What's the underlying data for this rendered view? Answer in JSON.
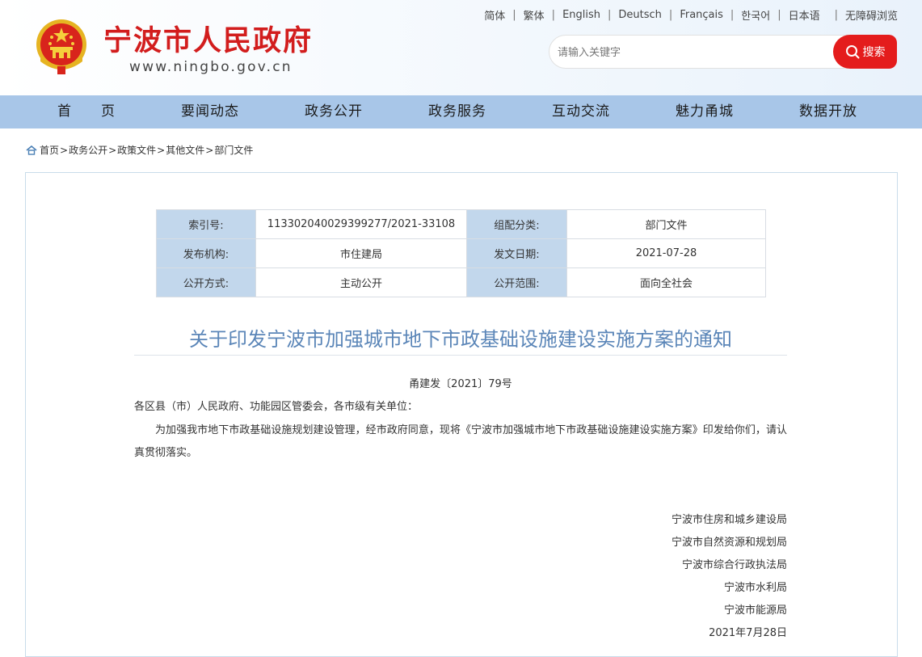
{
  "header": {
    "site_name": "宁波市人民政府",
    "site_url": "www.ningbo.gov.cn",
    "languages": [
      "简体",
      "繁体",
      "English",
      "Deutsch",
      "Français",
      "한국어",
      "日本语",
      "无障碍浏览"
    ],
    "search": {
      "placeholder": "请输入关键字",
      "button_label": "搜索"
    },
    "brand_red": "#d21d1d"
  },
  "nav": {
    "items": [
      "首　　页",
      "要闻动态",
      "政务公开",
      "政务服务",
      "互动交流",
      "魅力甬城",
      "数据开放"
    ],
    "bg_color": "#a8c6e8"
  },
  "breadcrumb": [
    "首页",
    "政务公开",
    "政策文件",
    "其他文件",
    "部门文件"
  ],
  "meta_table": [
    {
      "k1": "索引号:",
      "v1": "113302040029399277/2021-33108",
      "k2": "组配分类:",
      "v2": "部门文件"
    },
    {
      "k1": "发布机构:",
      "v1": "市住建局",
      "k2": "发文日期:",
      "v2": "2021-07-28"
    },
    {
      "k1": "公开方式:",
      "v1": "主动公开",
      "k2": "公开范围:",
      "v2": "面向全社会"
    }
  ],
  "document": {
    "title": "关于印发宁波市加强城市地下市政基础设施建设实施方案的通知",
    "doc_number": "甬建发〔2021〕79号",
    "addressee": "各区县（市）人民政府、功能园区管委会，各市级有关单位：",
    "body": "为加强我市地下市政基础设施规划建设管理，经市政府同意，现将《宁波市加强城市地下市政基础设施建设实施方案》印发给你们，请认真贯彻落实。",
    "signatories": [
      "宁波市住房和城乡建设局",
      "宁波市自然资源和规划局",
      "宁波市综合行政执法局",
      "宁波市水利局",
      "宁波市能源局"
    ],
    "date": "2021年7月28日",
    "title_color": "#5b86b8"
  }
}
